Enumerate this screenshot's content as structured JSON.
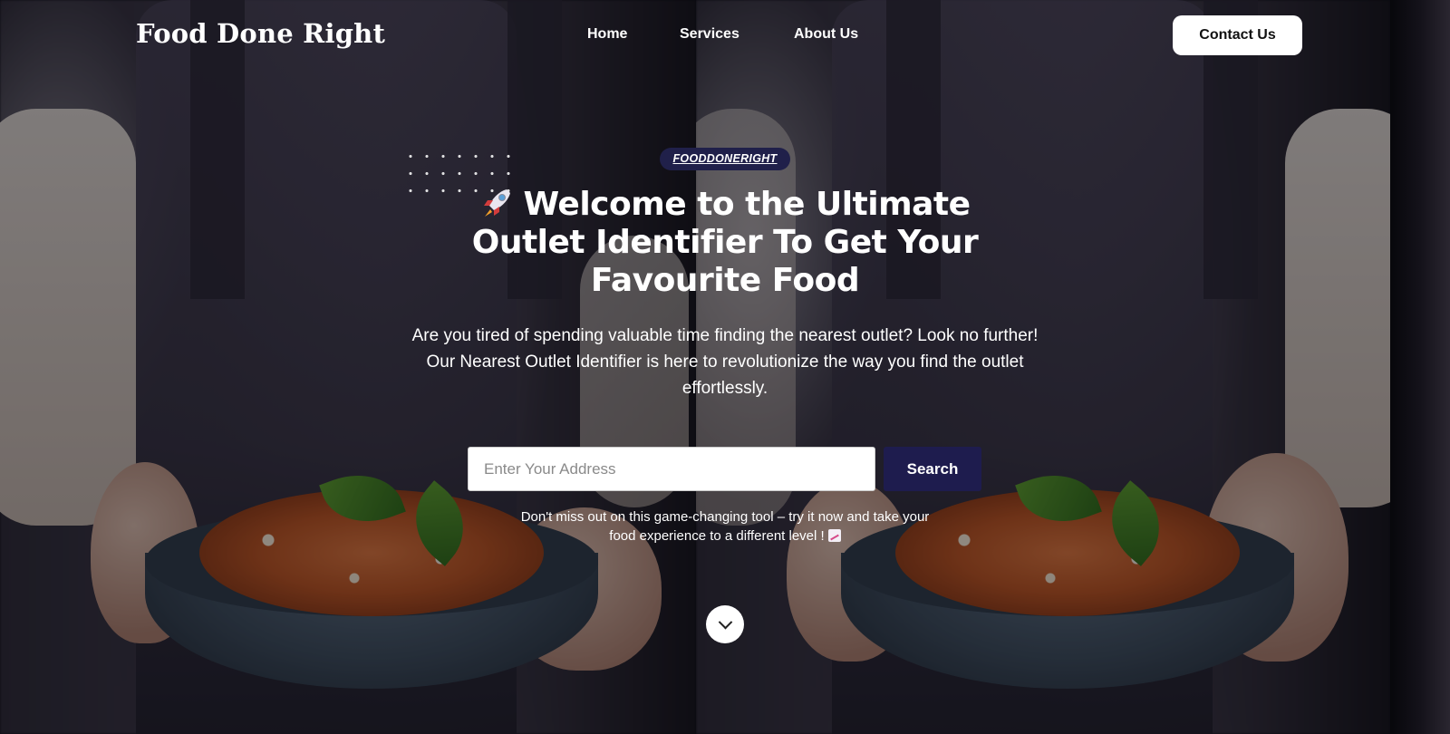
{
  "header": {
    "logo": "Food Done Right",
    "nav": {
      "home": "Home",
      "services": "Services",
      "about": "About Us"
    },
    "contact_label": "Contact Us"
  },
  "hero": {
    "badge": "FOODDONERIGHT",
    "headline_icon": "rocket-emoji",
    "headline": "Welcome to the Ultimate Outlet Identifier To Get Your Favourite Food",
    "intro": "Are you tired of spending valuable time finding the nearest outlet? Look no further! Our Nearest Outlet Identifier is here to revolutionize the way you find the outlet effortlessly.",
    "search": {
      "placeholder": "Enter Your Address",
      "value": "",
      "button_label": "Search"
    },
    "note": "Don't miss out on this game-changing tool – try it now and take your food experience to a different level !",
    "note_icon": "chart-increasing-emoji",
    "scroll_icon": "chevron-down-icon"
  },
  "colors": {
    "badge_bg": "#20204a",
    "search_button_bg": "#1e1c4e",
    "text": "#ffffff"
  }
}
